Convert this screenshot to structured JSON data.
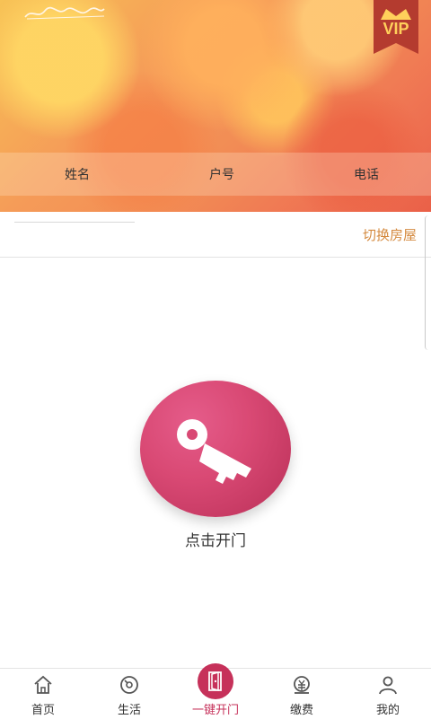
{
  "header": {
    "signature_text": "美城苏杭人家",
    "vip_label": "VIP"
  },
  "info": {
    "name_label": "姓名",
    "room_label": "户号",
    "phone_label": "电话"
  },
  "house": {
    "switch_label": "切换房屋"
  },
  "door": {
    "button_label": "点击开门"
  },
  "bottom_nav": {
    "items": [
      {
        "label": "首页",
        "icon": "home-icon"
      },
      {
        "label": "生活",
        "icon": "life-icon"
      },
      {
        "label": "一键开门",
        "icon": "door-icon"
      },
      {
        "label": "缴费",
        "icon": "payment-icon"
      },
      {
        "label": "我的",
        "icon": "profile-icon"
      }
    ],
    "active_index": 2
  },
  "colors": {
    "accent": "#c6315a",
    "switch_text": "#d4893e",
    "header_warm": "#f59b58"
  }
}
